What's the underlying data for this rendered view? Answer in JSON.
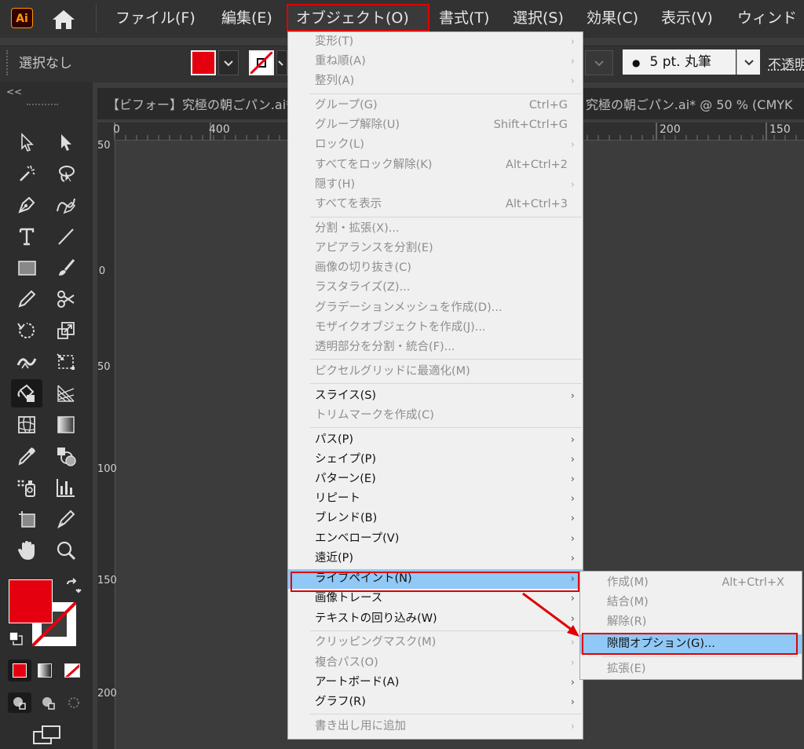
{
  "colors": {
    "accent_red": "#e00000",
    "fill": "#e5000f",
    "highlight": "#90c8f6",
    "menu_bg": "#f0f0f0"
  },
  "menubar": {
    "app_logo": "Ai",
    "items": [
      "ファイル(F)",
      "編集(E)",
      "オブジェクト(O)",
      "書式(T)",
      "選択(S)",
      "効果(C)",
      "表示(V)",
      "ウィンド"
    ]
  },
  "controlbar": {
    "selection": "選択なし",
    "brush_size": "5 pt. 丸筆",
    "opacity": "不透明"
  },
  "tabs": {
    "left": "【ビフォー】究極の朝ごパン.ai*",
    "right": "究極の朝ごパン.ai* @ 50 % (CMYK"
  },
  "ruler": {
    "top_ticks": [
      "0",
      "400",
      "200",
      "150"
    ],
    "left_ticks": [
      "50",
      "0",
      "50",
      "100",
      "150",
      "200"
    ]
  },
  "toolbox": {
    "collapse": "<<"
  },
  "object_menu": {
    "items": [
      {
        "label": "変形(T)",
        "shortcut": "",
        "submenu": true,
        "enabled": false
      },
      {
        "label": "重ね順(A)",
        "shortcut": "",
        "submenu": true,
        "enabled": false
      },
      {
        "label": "整列(A)",
        "shortcut": "",
        "submenu": true,
        "enabled": false
      },
      {
        "label": "グループ(G)",
        "shortcut": "Ctrl+G",
        "submenu": false,
        "enabled": false
      },
      {
        "label": "グループ解除(U)",
        "shortcut": "Shift+Ctrl+G",
        "submenu": false,
        "enabled": false
      },
      {
        "label": "ロック(L)",
        "shortcut": "",
        "submenu": true,
        "enabled": false
      },
      {
        "label": "すべてをロック解除(K)",
        "shortcut": "Alt+Ctrl+2",
        "submenu": false,
        "enabled": false
      },
      {
        "label": "隠す(H)",
        "shortcut": "",
        "submenu": true,
        "enabled": false
      },
      {
        "label": "すべてを表示",
        "shortcut": "Alt+Ctrl+3",
        "submenu": false,
        "enabled": false
      },
      {
        "label": "分割・拡張(X)...",
        "shortcut": "",
        "submenu": false,
        "enabled": false
      },
      {
        "label": "アピアランスを分割(E)",
        "shortcut": "",
        "submenu": false,
        "enabled": false
      },
      {
        "label": "画像の切り抜き(C)",
        "shortcut": "",
        "submenu": false,
        "enabled": false
      },
      {
        "label": "ラスタライズ(Z)...",
        "shortcut": "",
        "submenu": false,
        "enabled": false
      },
      {
        "label": "グラデーションメッシュを作成(D)...",
        "shortcut": "",
        "submenu": false,
        "enabled": false
      },
      {
        "label": "モザイクオブジェクトを作成(J)...",
        "shortcut": "",
        "submenu": false,
        "enabled": false
      },
      {
        "label": "透明部分を分割・統合(F)...",
        "shortcut": "",
        "submenu": false,
        "enabled": false
      },
      {
        "label": "ピクセルグリッドに最適化(M)",
        "shortcut": "",
        "submenu": false,
        "enabled": false
      },
      {
        "label": "スライス(S)",
        "shortcut": "",
        "submenu": true,
        "enabled": true
      },
      {
        "label": "トリムマークを作成(C)",
        "shortcut": "",
        "submenu": false,
        "enabled": false
      },
      {
        "label": "パス(P)",
        "shortcut": "",
        "submenu": true,
        "enabled": true
      },
      {
        "label": "シェイプ(P)",
        "shortcut": "",
        "submenu": true,
        "enabled": true
      },
      {
        "label": "パターン(E)",
        "shortcut": "",
        "submenu": true,
        "enabled": true
      },
      {
        "label": "リピート",
        "shortcut": "",
        "submenu": true,
        "enabled": true
      },
      {
        "label": "ブレンド(B)",
        "shortcut": "",
        "submenu": true,
        "enabled": true
      },
      {
        "label": "エンベロープ(V)",
        "shortcut": "",
        "submenu": true,
        "enabled": true
      },
      {
        "label": "遠近(P)",
        "shortcut": "",
        "submenu": true,
        "enabled": true
      },
      {
        "label": "ライブペイント(N)",
        "shortcut": "",
        "submenu": true,
        "enabled": true,
        "highlighted": true
      },
      {
        "label": "画像トレース",
        "shortcut": "",
        "submenu": true,
        "enabled": true
      },
      {
        "label": "テキストの回り込み(W)",
        "shortcut": "",
        "submenu": true,
        "enabled": true
      },
      {
        "label": "クリッピングマスク(M)",
        "shortcut": "",
        "submenu": true,
        "enabled": false
      },
      {
        "label": "複合パス(O)",
        "shortcut": "",
        "submenu": true,
        "enabled": false
      },
      {
        "label": "アートボード(A)",
        "shortcut": "",
        "submenu": true,
        "enabled": true
      },
      {
        "label": "グラフ(R)",
        "shortcut": "",
        "submenu": true,
        "enabled": true
      },
      {
        "label": "書き出し用に追加",
        "shortcut": "",
        "submenu": true,
        "enabled": false
      }
    ],
    "arrow": "›"
  },
  "livepaint_submenu": {
    "items": [
      {
        "label": "作成(M)",
        "shortcut": "Alt+Ctrl+X",
        "enabled": false
      },
      {
        "label": "結合(M)",
        "shortcut": "",
        "enabled": false
      },
      {
        "label": "解除(R)",
        "shortcut": "",
        "enabled": false
      },
      {
        "label": "隙間オプション(G)...",
        "shortcut": "",
        "enabled": true,
        "highlighted": true
      },
      {
        "label": "拡張(E)",
        "shortcut": "",
        "enabled": false
      }
    ]
  }
}
